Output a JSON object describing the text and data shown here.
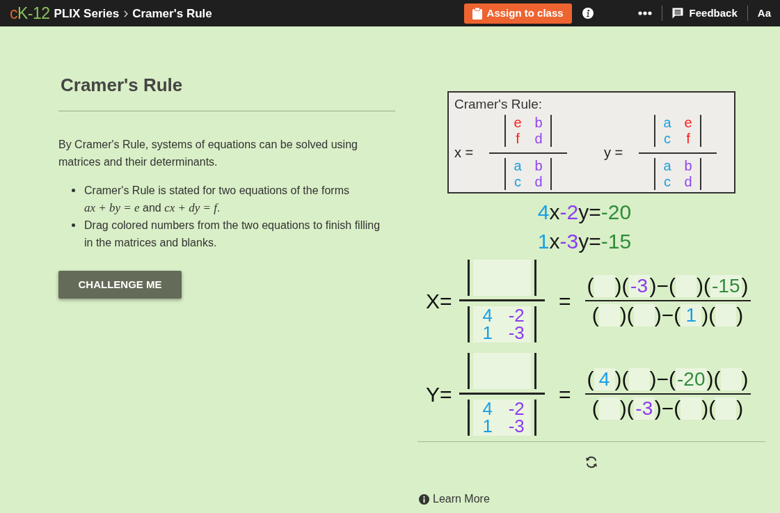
{
  "top_bar": {
    "logo": "cK-12",
    "breadcrumbs": [
      "PLIX Series",
      "Cramer's Rule"
    ],
    "assign_button": "Assign to class",
    "feedback_button": "Feedback",
    "text_size_button": "Aa"
  },
  "lesson": {
    "title": "Cramer's Rule",
    "intro": "By Cramer's Rule, systems of equations can be solved using matrices and their determinants.",
    "bullets": [
      "Cramer's Rule is stated for two equations of the forms *ax + by = e* and *cx + dy = f*.",
      "Drag colored numbers from the two equations to finish filling in the matrices and blanks."
    ],
    "challenge_button": "CHALLENGE ME"
  },
  "rule_card": {
    "title": "Cramer's Rule:",
    "formulas": [
      {
        "label": "x =",
        "numerator": [
          [
            {
              "text": "e",
              "color": "#ff1a1a"
            },
            {
              "text": "b",
              "color": "#8f45f0"
            }
          ],
          [
            {
              "text": "f",
              "color": "#ff1a1a"
            },
            {
              "text": "d",
              "color": "#8f45f0"
            }
          ]
        ],
        "denominator": [
          [
            {
              "text": "a",
              "color": "#1ba1e2"
            },
            {
              "text": "b",
              "color": "#8f45f0"
            }
          ],
          [
            {
              "text": "c",
              "color": "#1ba1e2"
            },
            {
              "text": "d",
              "color": "#8f45f0"
            }
          ]
        ]
      },
      {
        "label": "y =",
        "numerator": [
          [
            {
              "text": "a",
              "color": "#1ba1e2"
            },
            {
              "text": "e",
              "color": "#ff1a1a"
            }
          ],
          [
            {
              "text": "c",
              "color": "#1ba1e2"
            },
            {
              "text": "f",
              "color": "#ff1a1a"
            }
          ]
        ],
        "denominator": [
          [
            {
              "text": "a",
              "color": "#1ba1e2"
            },
            {
              "text": "b",
              "color": "#8f45f0"
            }
          ],
          [
            {
              "text": "c",
              "color": "#1ba1e2"
            },
            {
              "text": "d",
              "color": "#8f45f0"
            }
          ]
        ]
      }
    ]
  },
  "equations": [
    {
      "terms": [
        {
          "kind": "number",
          "text": "4",
          "color": "#1a9fe6"
        },
        {
          "kind": "symbol",
          "text": "x"
        },
        {
          "kind": "number",
          "text": "-2",
          "color": "#8b3df0"
        },
        {
          "kind": "symbol",
          "text": "y="
        },
        {
          "kind": "number",
          "text": "-20",
          "color": "#2f8c3b"
        }
      ]
    },
    {
      "terms": [
        {
          "kind": "number",
          "text": "1",
          "color": "#1a9fe6"
        },
        {
          "kind": "symbol",
          "text": "x"
        },
        {
          "kind": "number",
          "text": "-3",
          "color": "#8b3df0"
        },
        {
          "kind": "symbol",
          "text": "y="
        },
        {
          "kind": "number",
          "text": "-15",
          "color": "#2f8c3b"
        }
      ]
    }
  ],
  "solutions": [
    {
      "label": "X=",
      "denominator_matrix": {
        "rows": [
          [
            {
              "text": "4",
              "color": "#1a9fe6"
            },
            {
              "text": "-2",
              "color": "#8b3df0"
            }
          ],
          [
            {
              "text": "1",
              "color": "#1a9fe6"
            },
            {
              "text": "-3",
              "color": "#8b3df0"
            }
          ]
        ]
      },
      "equals": "=",
      "expansion": {
        "numerator": [
          {
            "kind": "text",
            "text": "("
          },
          {
            "kind": "slot"
          },
          {
            "kind": "text",
            "text": ")("
          },
          {
            "kind": "slot",
            "value": "-3",
            "color": "#8b3df0"
          },
          {
            "kind": "text",
            "text": ")−("
          },
          {
            "kind": "slot"
          },
          {
            "kind": "text",
            "text": ")("
          },
          {
            "kind": "slot",
            "value": "-15",
            "color": "#2f8c3b"
          },
          {
            "kind": "text",
            "text": ")"
          }
        ],
        "denominator": [
          {
            "kind": "text",
            "text": "("
          },
          {
            "kind": "slot"
          },
          {
            "kind": "text",
            "text": ")("
          },
          {
            "kind": "slot"
          },
          {
            "kind": "text",
            "text": ")−("
          },
          {
            "kind": "slot",
            "value": "1",
            "color": "#1a9fe6"
          },
          {
            "kind": "text",
            "text": ")("
          },
          {
            "kind": "slot"
          },
          {
            "kind": "text",
            "text": ")"
          }
        ]
      }
    },
    {
      "label": "Y=",
      "denominator_matrix": {
        "rows": [
          [
            {
              "text": "4",
              "color": "#1a9fe6"
            },
            {
              "text": "-2",
              "color": "#8b3df0"
            }
          ],
          [
            {
              "text": "1",
              "color": "#1a9fe6"
            },
            {
              "text": "-3",
              "color": "#8b3df0"
            }
          ]
        ]
      },
      "equals": "=",
      "expansion": {
        "numerator": [
          {
            "kind": "text",
            "text": "("
          },
          {
            "kind": "slot",
            "value": "4",
            "color": "#1a9fe6"
          },
          {
            "kind": "text",
            "text": ")("
          },
          {
            "kind": "slot"
          },
          {
            "kind": "text",
            "text": ")−("
          },
          {
            "kind": "slot",
            "value": "-20",
            "color": "#2f8c3b"
          },
          {
            "kind": "text",
            "text": ")("
          },
          {
            "kind": "slot"
          },
          {
            "kind": "text",
            "text": ")"
          }
        ],
        "denominator": [
          {
            "kind": "text",
            "text": "("
          },
          {
            "kind": "slot"
          },
          {
            "kind": "text",
            "text": ")("
          },
          {
            "kind": "slot",
            "value": "-3",
            "color": "#8b3df0"
          },
          {
            "kind": "text",
            "text": ")−("
          },
          {
            "kind": "slot"
          },
          {
            "kind": "text",
            "text": ")("
          },
          {
            "kind": "slot"
          },
          {
            "kind": "text",
            "text": ")"
          }
        ]
      }
    }
  ],
  "learn_more": "Learn More"
}
